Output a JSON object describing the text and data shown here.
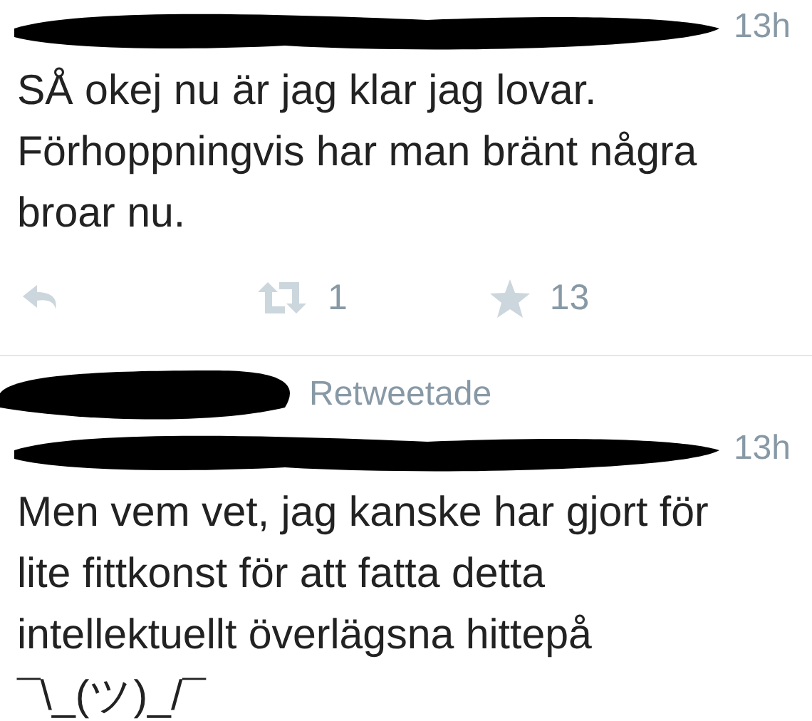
{
  "tweets": [
    {
      "time": "13h",
      "text": [
        "SÅ okej nu är jag klar jag lovar.",
        "Förhoppningvis har man bränt några",
        "broar nu."
      ],
      "actions": {
        "retweets": "1",
        "favorites": "13"
      }
    },
    {
      "retweeted_label": "Retweetade",
      "time": "13h",
      "text": [
        "Men vem vet, jag kanske har gjort för",
        "lite fittkonst för att fatta detta",
        "intellektuellt överlägsna hittepå",
        "¯\\_(ツ)_/¯"
      ]
    }
  ]
}
